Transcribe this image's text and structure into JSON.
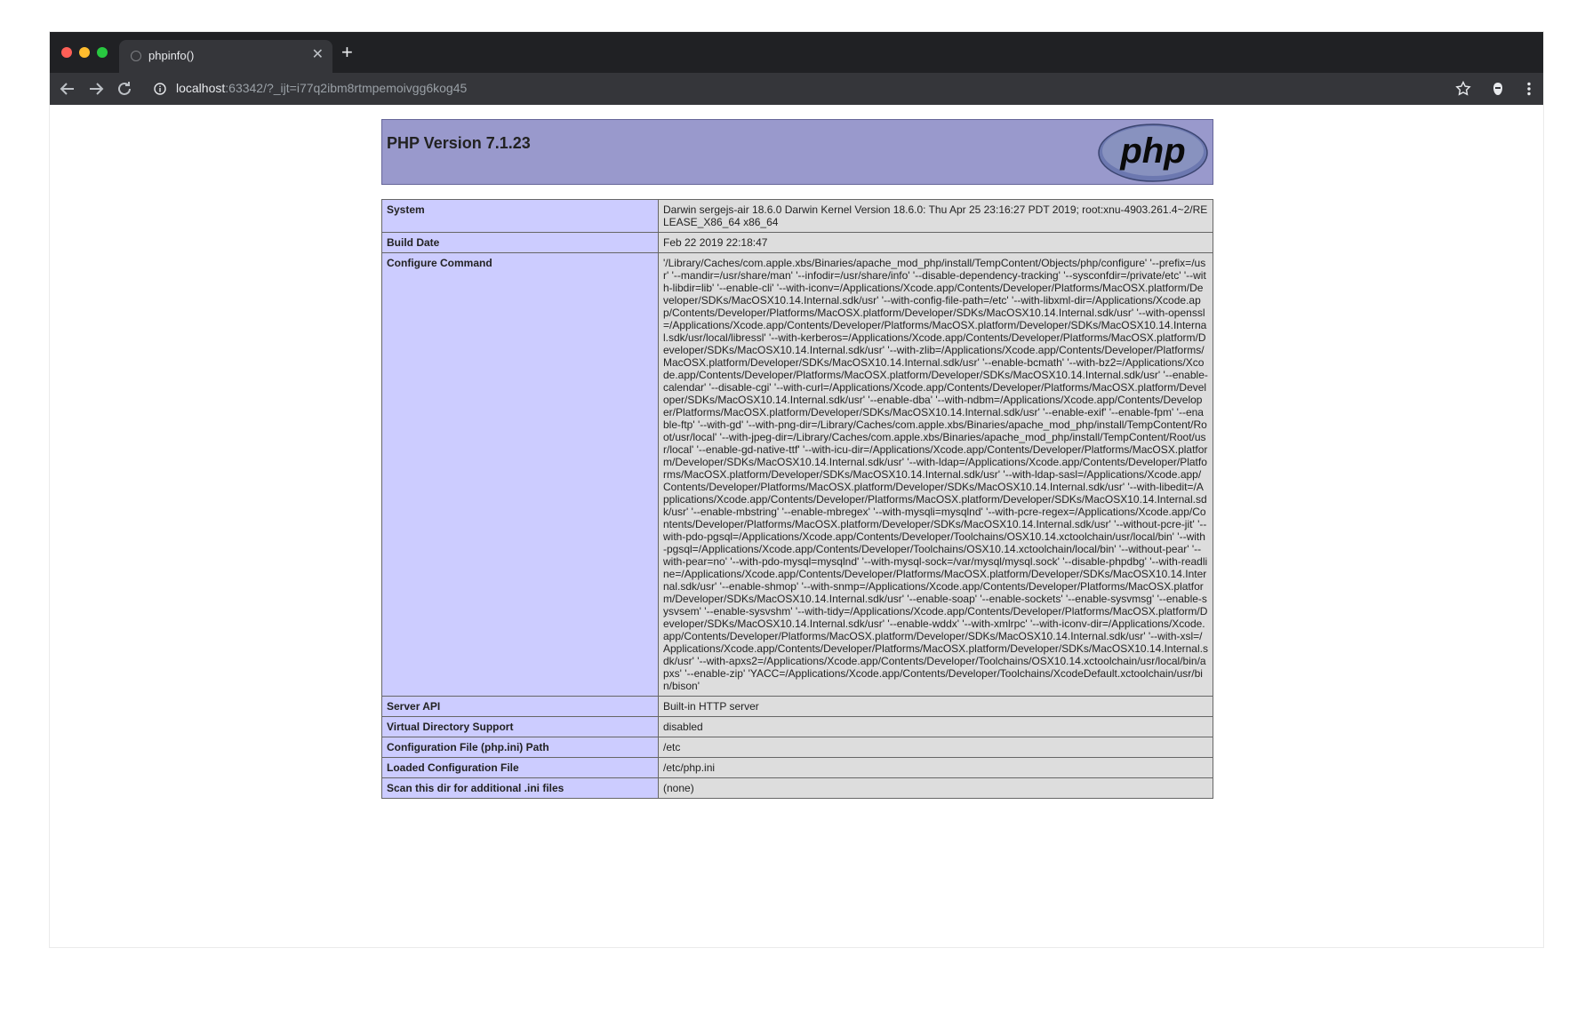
{
  "browser": {
    "tab_title": "phpinfo()",
    "url_host": "localhost",
    "url_rest": ":63342/?_ijt=i77q2ibm8rtmpemoivgg6kog45"
  },
  "header": {
    "title": "PHP Version 7.1.23",
    "logo_text": "php"
  },
  "rows": [
    {
      "label": "System",
      "value": "Darwin sergejs-air 18.6.0 Darwin Kernel Version 18.6.0: Thu Apr 25 23:16:27 PDT 2019; root:xnu-4903.261.4~2/RELEASE_X86_64 x86_64"
    },
    {
      "label": "Build Date",
      "value": "Feb 22 2019 22:18:47"
    },
    {
      "label": "Configure Command",
      "value": "'/Library/Caches/com.apple.xbs/Binaries/apache_mod_php/install/TempContent/Objects/php/configure' '--prefix=/usr' '--mandir=/usr/share/man' '--infodir=/usr/share/info' '--disable-dependency-tracking' '--sysconfdir=/private/etc' '--with-libdir=lib' '--enable-cli' '--with-iconv=/Applications/Xcode.app/Contents/Developer/Platforms/MacOSX.platform/Developer/SDKs/MacOSX10.14.Internal.sdk/usr' '--with-config-file-path=/etc' '--with-libxml-dir=/Applications/Xcode.app/Contents/Developer/Platforms/MacOSX.platform/Developer/SDKs/MacOSX10.14.Internal.sdk/usr' '--with-openssl=/Applications/Xcode.app/Contents/Developer/Platforms/MacOSX.platform/Developer/SDKs/MacOSX10.14.Internal.sdk/usr/local/libressl' '--with-kerberos=/Applications/Xcode.app/Contents/Developer/Platforms/MacOSX.platform/Developer/SDKs/MacOSX10.14.Internal.sdk/usr' '--with-zlib=/Applications/Xcode.app/Contents/Developer/Platforms/MacOSX.platform/Developer/SDKs/MacOSX10.14.Internal.sdk/usr' '--enable-bcmath' '--with-bz2=/Applications/Xcode.app/Contents/Developer/Platforms/MacOSX.platform/Developer/SDKs/MacOSX10.14.Internal.sdk/usr' '--enable-calendar' '--disable-cgi' '--with-curl=/Applications/Xcode.app/Contents/Developer/Platforms/MacOSX.platform/Developer/SDKs/MacOSX10.14.Internal.sdk/usr' '--enable-dba' '--with-ndbm=/Applications/Xcode.app/Contents/Developer/Platforms/MacOSX.platform/Developer/SDKs/MacOSX10.14.Internal.sdk/usr' '--enable-exif' '--enable-fpm' '--enable-ftp' '--with-gd' '--with-png-dir=/Library/Caches/com.apple.xbs/Binaries/apache_mod_php/install/TempContent/Root/usr/local' '--with-jpeg-dir=/Library/Caches/com.apple.xbs/Binaries/apache_mod_php/install/TempContent/Root/usr/local' '--enable-gd-native-ttf' '--with-icu-dir=/Applications/Xcode.app/Contents/Developer/Platforms/MacOSX.platform/Developer/SDKs/MacOSX10.14.Internal.sdk/usr' '--with-ldap=/Applications/Xcode.app/Contents/Developer/Platforms/MacOSX.platform/Developer/SDKs/MacOSX10.14.Internal.sdk/usr' '--with-ldap-sasl=/Applications/Xcode.app/Contents/Developer/Platforms/MacOSX.platform/Developer/SDKs/MacOSX10.14.Internal.sdk/usr' '--with-libedit=/Applications/Xcode.app/Contents/Developer/Platforms/MacOSX.platform/Developer/SDKs/MacOSX10.14.Internal.sdk/usr' '--enable-mbstring' '--enable-mbregex' '--with-mysqli=mysqlnd' '--with-pcre-regex=/Applications/Xcode.app/Contents/Developer/Platforms/MacOSX.platform/Developer/SDKs/MacOSX10.14.Internal.sdk/usr' '--without-pcre-jit' '--with-pdo-pgsql=/Applications/Xcode.app/Contents/Developer/Toolchains/OSX10.14.xctoolchain/usr/local/bin' '--with-pgsql=/Applications/Xcode.app/Contents/Developer/Toolchains/OSX10.14.xctoolchain/local/bin' '--without-pear' '--with-pear=no' '--with-pdo-mysql=mysqlnd' '--with-mysql-sock=/var/mysql/mysql.sock' '--disable-phpdbg' '--with-readline=/Applications/Xcode.app/Contents/Developer/Platforms/MacOSX.platform/Developer/SDKs/MacOSX10.14.Internal.sdk/usr' '--enable-shmop' '--with-snmp=/Applications/Xcode.app/Contents/Developer/Platforms/MacOSX.platform/Developer/SDKs/MacOSX10.14.Internal.sdk/usr' '--enable-soap' '--enable-sockets' '--enable-sysvmsg' '--enable-sysvsem' '--enable-sysvshm' '--with-tidy=/Applications/Xcode.app/Contents/Developer/Platforms/MacOSX.platform/Developer/SDKs/MacOSX10.14.Internal.sdk/usr' '--enable-wddx' '--with-xmlrpc' '--with-iconv-dir=/Applications/Xcode.app/Contents/Developer/Platforms/MacOSX.platform/Developer/SDKs/MacOSX10.14.Internal.sdk/usr' '--with-xsl=/Applications/Xcode.app/Contents/Developer/Platforms/MacOSX.platform/Developer/SDKs/MacOSX10.14.Internal.sdk/usr' '--with-apxs2=/Applications/Xcode.app/Contents/Developer/Toolchains/OSX10.14.xctoolchain/usr/local/bin/apxs' '--enable-zip' 'YACC=/Applications/Xcode.app/Contents/Developer/Toolchains/XcodeDefault.xctoolchain/usr/bin/bison'"
    },
    {
      "label": "Server API",
      "value": "Built-in HTTP server"
    },
    {
      "label": "Virtual Directory Support",
      "value": "disabled"
    },
    {
      "label": "Configuration File (php.ini) Path",
      "value": "/etc"
    },
    {
      "label": "Loaded Configuration File",
      "value": "/etc/php.ini"
    },
    {
      "label": "Scan this dir for additional .ini files",
      "value": "(none)"
    }
  ],
  "icons": {
    "back": "arrow-left-icon",
    "forward": "arrow-right-icon",
    "reload": "reload-icon",
    "info": "info-icon",
    "star": "star-icon",
    "extension": "extension-icon",
    "menu": "kebab-menu-icon"
  }
}
